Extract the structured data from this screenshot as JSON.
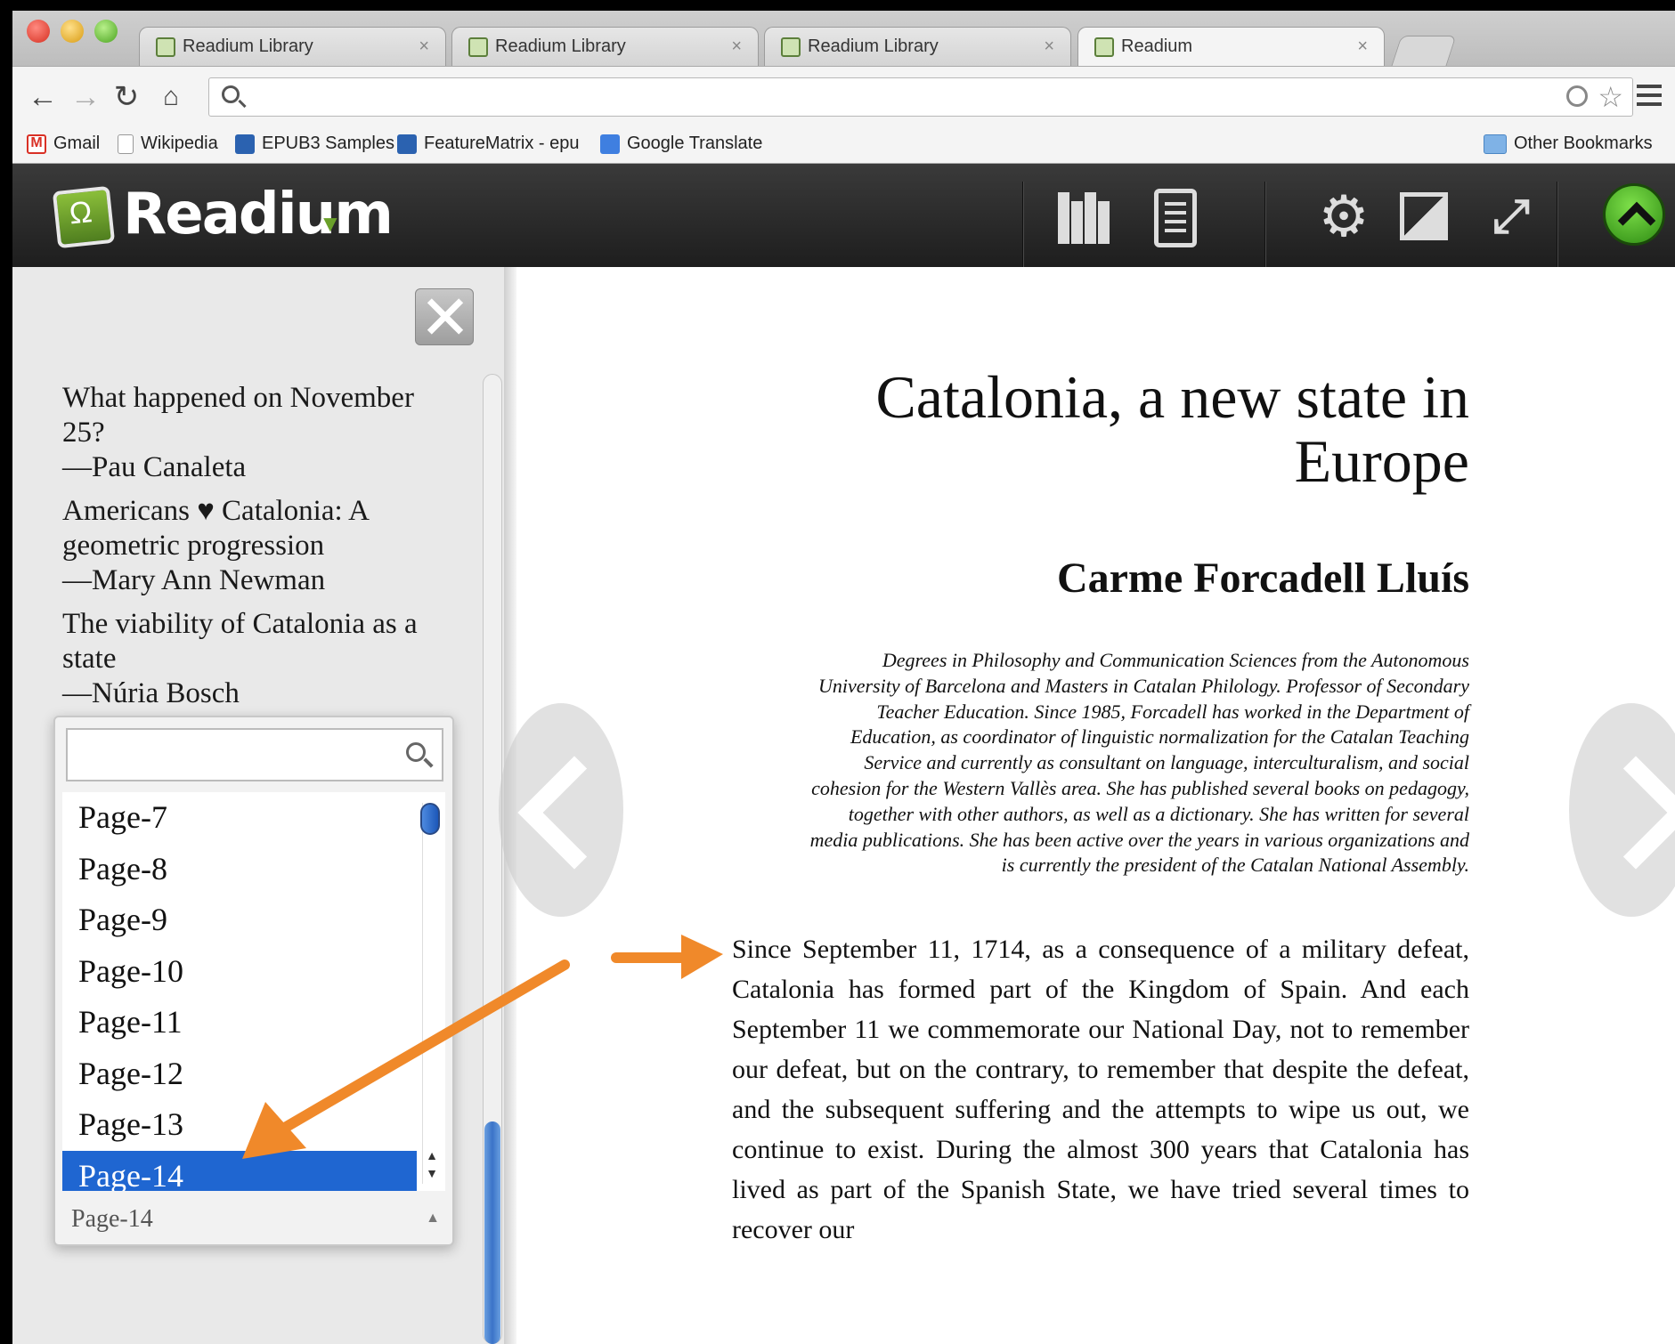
{
  "browser": {
    "tabs": [
      {
        "title": "Readium Library"
      },
      {
        "title": "Readium Library"
      },
      {
        "title": "Readium Library"
      },
      {
        "title": "Readium"
      }
    ],
    "tab_close_glyph": "×",
    "bookmarks": [
      {
        "label": "Gmail",
        "icon": "gmail-icon"
      },
      {
        "label": "Wikipedia",
        "icon": "page-icon"
      },
      {
        "label": "EPUB3 Samples",
        "icon": "house-icon"
      },
      {
        "label": "FeatureMatrix - epu",
        "icon": "house-icon"
      },
      {
        "label": "Google Translate",
        "icon": "translate-icon"
      }
    ],
    "other_bookmarks": "Other Bookmarks"
  },
  "app": {
    "name": "Readium",
    "brand_color": "#6aa02a"
  },
  "sidebar": {
    "toc": [
      {
        "title": "What happened on November 25?",
        "author": "—Pau Canaleta"
      },
      {
        "title": "Americans ♥ Catalonia: A geometric progression",
        "author": "—Mary Ann Newman"
      },
      {
        "title": "The viability of Catalonia as a state",
        "author": "—Núria Bosch"
      }
    ],
    "page_select": {
      "search_value": "",
      "options": [
        "Page-7",
        "Page-8",
        "Page-9",
        "Page-10",
        "Page-11",
        "Page-12",
        "Page-13",
        "Page-14"
      ],
      "selected": "Page-14",
      "current_value": "Page-14",
      "highlight_color": "#1f66d1"
    }
  },
  "content": {
    "title_line1": "Catalonia, a new state in",
    "title_line2": "Europe",
    "author": "Carme Forcadell Lluís",
    "bio": "Degrees in Philosophy and Communication Sciences from the Autonomous University of Barcelona and Masters in Catalan Philology. Professor of Secondary Teacher Education. Since 1985, Forcadell has worked in the Department of Education, as coordinator of linguistic normalization for the Catalan Teaching Service and currently as consultant on language, interculturalism, and social cohesion for the Western Vallès area. She has published several books on pedagogy, together with other authors, as well as a dictionary. She has written for several media publications. She has been active over the years in various organizations and is currently the president of the Catalan National Assembly.",
    "body": "Since September 11, 1714, as a consequence of a military defeat, Catalonia has formed part of the Kingdom of Spain. And each September 11 we commemorate our National Day, not to remember our defeat, but on the contrary, to remember that despite the defeat, and the subsequent suffering and the attempts to wipe us out, we continue to exist. During the almost 300 years that Catalonia has lived as part of the Spanish State, we have tried several times to recover our"
  },
  "annotation": {
    "arrow_color": "#f0892a"
  }
}
